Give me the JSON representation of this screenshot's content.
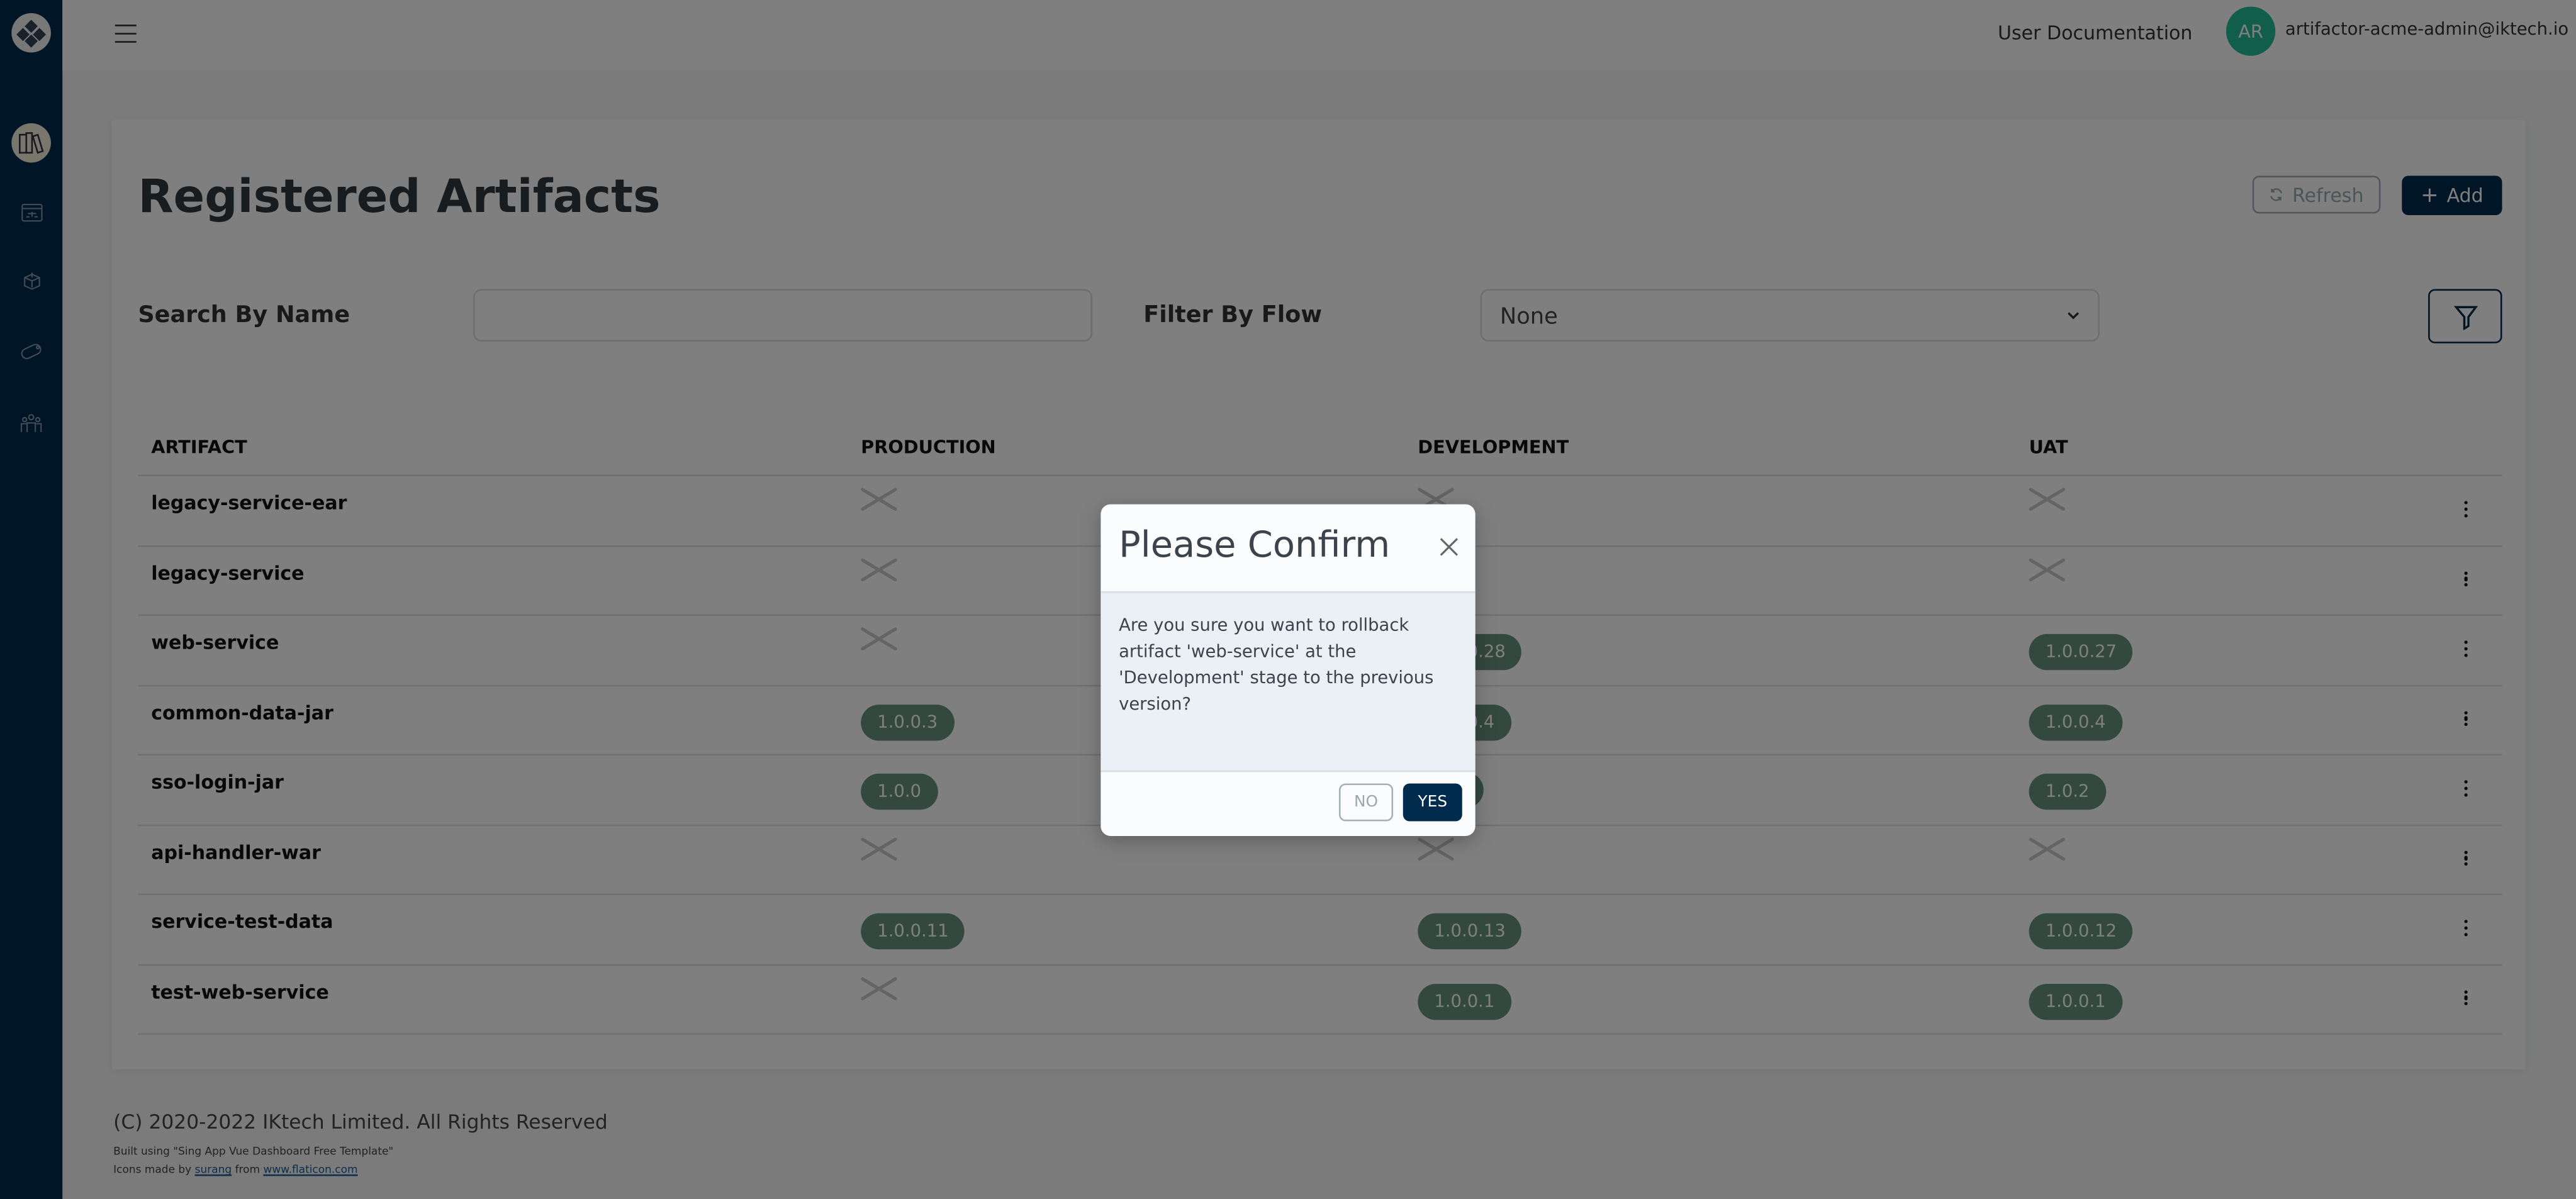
{
  "colors": {
    "sidebar": "#002b4d",
    "primary": "#002b4d",
    "badge": "#66907e",
    "avatar": "#22bc97"
  },
  "sidebar": {
    "items": [
      {
        "icon": "logo-icon"
      },
      {
        "icon": "library-books-icon",
        "active": true
      },
      {
        "icon": "flow-browser-icon"
      },
      {
        "icon": "network-cube-icon"
      },
      {
        "icon": "tag-icon"
      },
      {
        "icon": "team-icon"
      }
    ]
  },
  "header": {
    "doc_link": "User Documentation",
    "avatar_initials": "AR",
    "user_email": "artifactor-acme-admin@iktech.io"
  },
  "page": {
    "title": "Registered Artifacts",
    "refresh_label": "Refresh",
    "add_label": "Add",
    "search_label": "Search By Name",
    "search_value": "",
    "filter_label": "Filter By Flow",
    "filter_value": "None"
  },
  "table": {
    "columns": [
      "ARTIFACT",
      "PRODUCTION",
      "DEVELOPMENT",
      "UAT"
    ],
    "rows": [
      {
        "name": "legacy-service-ear",
        "production": null,
        "development": null,
        "uat": null
      },
      {
        "name": "legacy-service",
        "production": null,
        "development": null,
        "uat": null
      },
      {
        "name": "web-service",
        "production": null,
        "development": "1.0.0.28",
        "uat": "1.0.0.27"
      },
      {
        "name": "common-data-jar",
        "production": "1.0.0.3",
        "development": "1.0.0.4",
        "uat": "1.0.0.4"
      },
      {
        "name": "sso-login-jar",
        "production": "1.0.0",
        "development": "",
        "uat": "1.0.2"
      },
      {
        "name": "api-handler-war",
        "production": null,
        "development": null,
        "uat": null
      },
      {
        "name": "service-test-data",
        "production": "1.0.0.11",
        "development": "1.0.0.13",
        "uat": "1.0.0.12"
      },
      {
        "name": "test-web-service",
        "production": null,
        "development": "1.0.0.1",
        "uat": "1.0.0.1"
      }
    ]
  },
  "footer": {
    "copyright": "(C) 2020-2022 IKtech Limited. All Rights Reserved",
    "built_using": "Built using \"Sing App Vue Dashboard Free Template\"",
    "icons_prefix": "Icons made by ",
    "icons_author": "surang",
    "icons_from": " from ",
    "icons_site": "www.flaticon.com"
  },
  "dialog": {
    "title": "Please Confirm",
    "message": "Are you sure you want to rollback artifact 'web-service' at the 'Development' stage to the previous version?",
    "no_label": "NO",
    "yes_label": "YES"
  }
}
